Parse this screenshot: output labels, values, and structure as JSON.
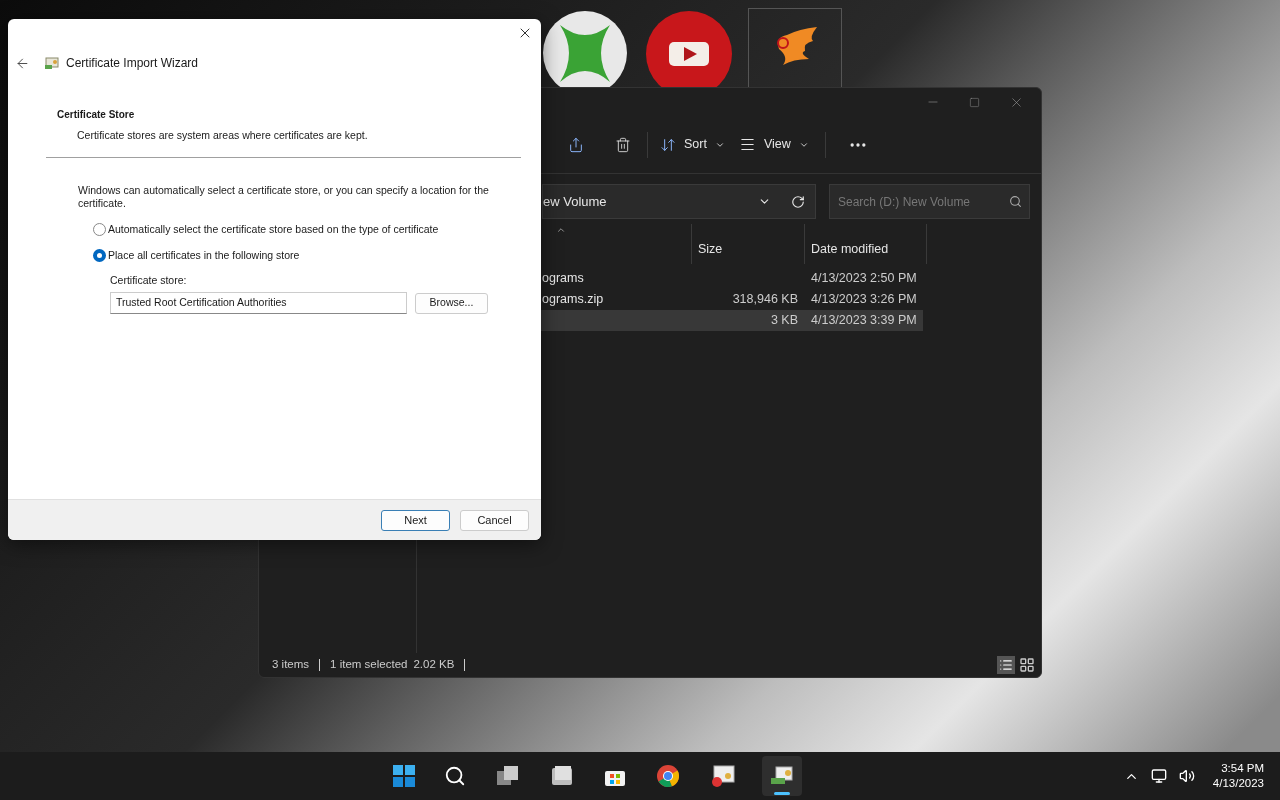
{
  "dialog": {
    "title": "Certificate Import Wizard",
    "heading": "Certificate Store",
    "subheading": "Certificate stores are system areas where certificates are kept.",
    "intro": "Windows can automatically select a certificate store, or you can specify a location for the certificate.",
    "options": [
      {
        "label": "Automatically select the certificate store based on the type of certificate",
        "selected": false
      },
      {
        "label": "Place all certificates in the following store",
        "selected": true
      }
    ],
    "store_label": "Certificate store:",
    "store_value": "Trusted Root Certification Authorities",
    "browse": "Browse...",
    "buttons": [
      {
        "label": "Next",
        "kind": "primary"
      },
      {
        "label": "Cancel",
        "kind": "secondary"
      }
    ]
  },
  "explorer": {
    "toolbar": [
      {
        "label": "Sort",
        "kind": "sort"
      },
      {
        "label": "View",
        "kind": "view"
      }
    ],
    "address": "ew Volume",
    "search": {
      "placeholder": "Search (D:) New Volume"
    },
    "columns": [
      "Size",
      "Date modified"
    ],
    "rows": [
      {
        "name": "ograms",
        "date": "4/13/2023 2:50 PM",
        "selected": false
      },
      {
        "name": "ograms.zip",
        "size": "318,946 KB",
        "date": "4/13/2023 3:26 PM",
        "selected": false
      },
      {
        "size": "3 KB",
        "date": "4/13/2023 3:39 PM",
        "selected": true
      }
    ],
    "status": [
      "3 items",
      "1 item selected",
      "2.02 KB"
    ]
  },
  "taskbar": {
    "time": "3:54 PM",
    "date": "4/13/2023"
  }
}
